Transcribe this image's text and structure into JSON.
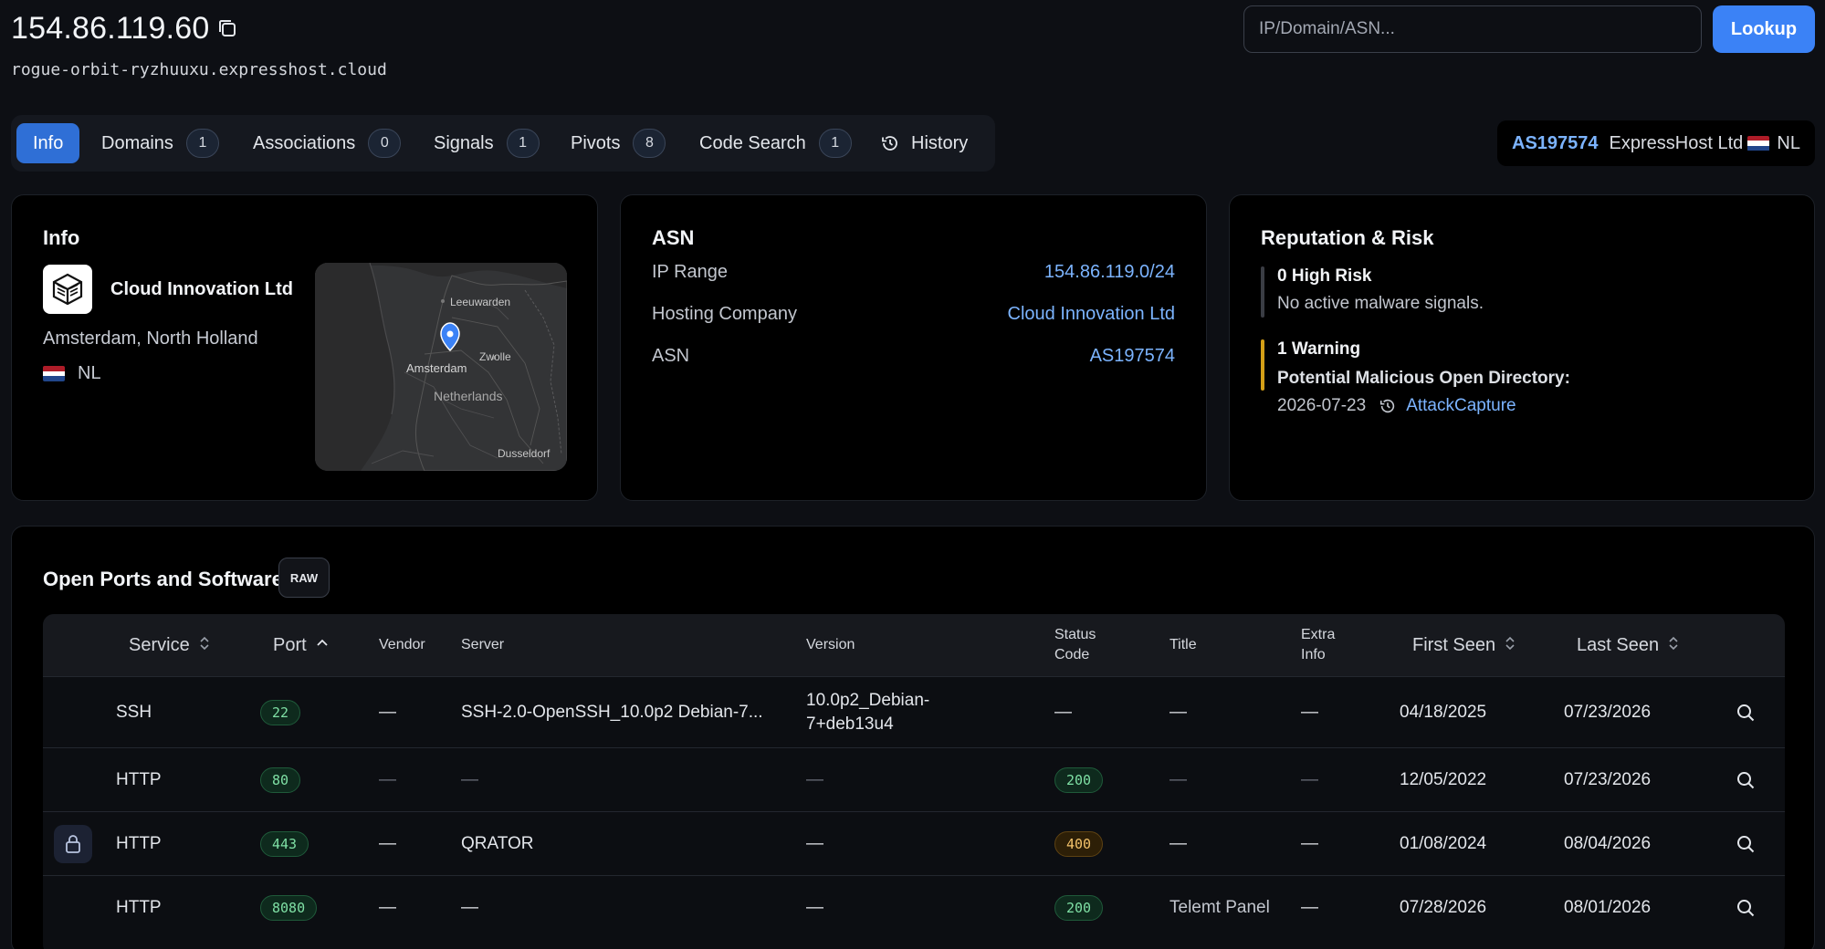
{
  "header": {
    "ip": "154.86.119.60",
    "hostname": "rogue-orbit-ryzhuuxu.expresshost.cloud",
    "search_placeholder": "IP/Domain/ASN...",
    "lookup_label": "Lookup"
  },
  "tabs": [
    {
      "label": "Info",
      "active": true
    },
    {
      "label": "Domains",
      "count": "1"
    },
    {
      "label": "Associations",
      "count": "0"
    },
    {
      "label": "Signals",
      "count": "1"
    },
    {
      "label": "Pivots",
      "count": "8"
    },
    {
      "label": "Code Search",
      "count": "1"
    },
    {
      "label": "History",
      "icon": "history-icon"
    }
  ],
  "asn_pill": {
    "asn": "AS197574",
    "name": "ExpressHost Ltd",
    "country": "NL"
  },
  "info_card": {
    "title": "Info",
    "company": "Cloud Innovation Ltd",
    "location": "Amsterdam, North Holland",
    "country": "NL",
    "map_labels": {
      "leeuwarden": "Leeuwarden",
      "zwolle": "Zwolle",
      "amsterdam": "Amsterdam",
      "netherlands": "Netherlands",
      "dusseldorf": "Dusseldorf"
    }
  },
  "asn_card": {
    "title": "ASN",
    "rows": [
      {
        "key": "IP Range",
        "value": "154.86.119.0/24"
      },
      {
        "key": "Hosting Company",
        "value": "Cloud Innovation Ltd"
      },
      {
        "key": "ASN",
        "value": "AS197574"
      }
    ]
  },
  "risk_card": {
    "title": "Reputation & Risk",
    "high_risk": {
      "heading": "0 High Risk",
      "text": "No active malware signals."
    },
    "warning": {
      "heading": "1 Warning",
      "text": "Potential Malicious Open Directory:",
      "date": "2026-07-23",
      "source": "AttackCapture"
    }
  },
  "ports": {
    "title": "Open Ports and Software",
    "raw_label": "RAW",
    "columns": {
      "service": "Service",
      "port": "Port",
      "vendor": "Vendor",
      "server": "Server",
      "version": "Version",
      "status_line1": "Status",
      "status_line2": "Code",
      "title": "Title",
      "extra_line1": "Extra",
      "extra_line2": "Info",
      "first_seen": "First Seen",
      "last_seen": "Last Seen"
    },
    "rows": [
      {
        "lock": false,
        "service": "SSH",
        "port": "22",
        "vendor": "—",
        "server": "SSH-2.0-OpenSSH_10.0p2 Debian-7...",
        "version_line1": "10.0p2_Debian-",
        "version_line2": "7+deb13u4",
        "status": "—",
        "title": "—",
        "extra": "—",
        "first_seen": "04/18/2025",
        "last_seen": "07/23/2026"
      },
      {
        "lock": false,
        "service": "HTTP",
        "port": "80",
        "vendor": "—",
        "server": "—",
        "version_line1": "—",
        "version_line2": "",
        "status": "200",
        "title": "—",
        "extra": "—",
        "first_seen": "12/05/2022",
        "last_seen": "07/23/2026"
      },
      {
        "lock": true,
        "service": "HTTP",
        "port": "443",
        "vendor": "—",
        "server": "QRATOR",
        "version_line1": "—",
        "version_line2": "",
        "status": "400",
        "title": "—",
        "extra": "—",
        "first_seen": "01/08/2024",
        "last_seen": "08/04/2026"
      },
      {
        "lock": false,
        "service": "HTTP",
        "port": "8080",
        "vendor": "—",
        "server": "—",
        "version_line1": "—",
        "version_line2": "",
        "status": "200",
        "title": "Telemt Panel",
        "extra": "—",
        "first_seen": "07/28/2026",
        "last_seen": "08/01/2026"
      }
    ]
  },
  "colors": {
    "accent": "#3b82f6",
    "link": "#7cb4ff",
    "warning": "#d4a017",
    "status_ok": "#7fe0a5",
    "status_warn": "#f3c26a"
  }
}
